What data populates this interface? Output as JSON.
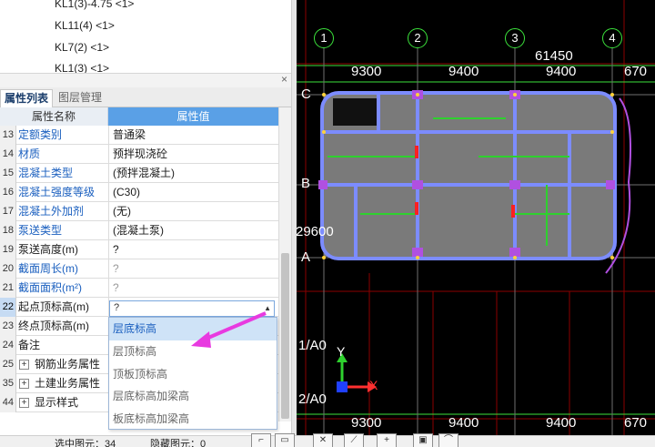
{
  "tree": {
    "items": [
      "KL1(3)-4.75 <1>",
      "KL11(4) <1>",
      "KL7(2) <1>",
      "KL1(3) <1>"
    ]
  },
  "panel": {
    "close_icon": "×",
    "tabs": [
      "属性列表",
      "图层管理"
    ],
    "columns": [
      "属性名称",
      "属性值"
    ]
  },
  "properties": [
    {
      "idx": "13",
      "name": "定额类别",
      "value": "普通梁",
      "name_color": "blue",
      "value_color": "dark"
    },
    {
      "idx": "14",
      "name": "材质",
      "value": "预拌现浇砼",
      "name_color": "blue",
      "value_color": "dark"
    },
    {
      "idx": "15",
      "name": "混凝土类型",
      "value": "(预拌混凝土)",
      "name_color": "blue",
      "value_color": "dark"
    },
    {
      "idx": "16",
      "name": "混凝土强度等级",
      "value": "(C30)",
      "name_color": "blue",
      "value_color": "dark"
    },
    {
      "idx": "17",
      "name": "混凝土外加剂",
      "value": "(无)",
      "name_color": "blue",
      "value_color": "dark"
    },
    {
      "idx": "18",
      "name": "泵送类型",
      "value": "(混凝土泵)",
      "name_color": "blue",
      "value_color": "dark"
    },
    {
      "idx": "19",
      "name": "泵送高度(m)",
      "value": "?",
      "name_color": "dark",
      "value_color": "dark"
    },
    {
      "idx": "20",
      "name": "截面周长(m)",
      "value": "?",
      "name_color": "blue",
      "value_color": "gray"
    },
    {
      "idx": "21",
      "name": "截面面积(m²)",
      "value": "?",
      "name_color": "blue",
      "value_color": "gray"
    },
    {
      "idx": "22",
      "name": "起点顶标高(m)",
      "value": "",
      "name_color": "dark",
      "value_color": "dark"
    },
    {
      "idx": "23",
      "name": "终点顶标高(m)",
      "value": "",
      "name_color": "dark",
      "value_color": "dark"
    },
    {
      "idx": "24",
      "name": "备注",
      "value": "",
      "name_color": "dark",
      "value_color": "dark"
    }
  ],
  "groups": [
    {
      "idx": "25",
      "name": "钢筋业务属性"
    },
    {
      "idx": "35",
      "name": "土建业务属性"
    },
    {
      "idx": "44",
      "name": "显示样式"
    }
  ],
  "combo": {
    "value": "?"
  },
  "dropdown": {
    "options": [
      "层底标高",
      "层顶标高",
      "顶板顶标高",
      "层底标高加梁高",
      "板底标高加梁高"
    ],
    "selected": "层底标高"
  },
  "statusbar": {
    "selected_label": "选中图元：34",
    "hidden_label": "隐藏图元：0"
  },
  "cad": {
    "axes_top": [
      "1",
      "2",
      "3",
      "4"
    ],
    "dims_top": {
      "total": "61450",
      "d1": "9300",
      "d2": "9400",
      "d3": "9400",
      "d4": "670"
    },
    "dims_bottom": {
      "d1": "9300",
      "d2": "9400",
      "d3": "9400",
      "d4": "670"
    },
    "row_labels": [
      "C",
      "B",
      "A"
    ],
    "side_dim": "29600",
    "axis_notes": [
      "1/A0",
      "2/A0"
    ],
    "ucs": {
      "y": "Y",
      "x": "X"
    }
  },
  "colors": {
    "accent": "#5aa0e6",
    "link": "#1a5fbf",
    "cad_bg": "#000000",
    "grid_green": "#3be23b",
    "beam_blue": "#6b8cff",
    "arrow_magenta": "#e83ae0"
  }
}
